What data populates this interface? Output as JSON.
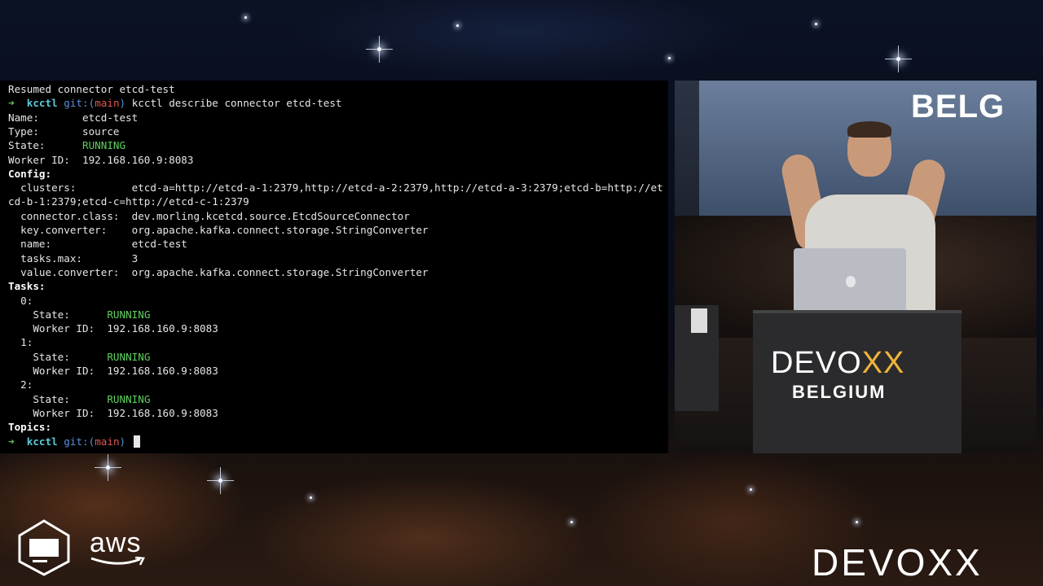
{
  "terminal": {
    "lines": [
      {
        "a": "Resumed connector etcd-test"
      },
      {
        "arrow": "➜",
        "dir": "kcctl",
        "git": "git:(",
        "branch": "main",
        "git_end": ")",
        "cmd": " kcctl describe connector etcd-test"
      },
      {
        "a": "Name:       etcd-test"
      },
      {
        "a": "Type:       source"
      },
      {
        "a": "State:      ",
        "b": "RUNNING"
      },
      {
        "a": "Worker ID:  192.168.160.9:8083"
      },
      {
        "a": "Config:"
      },
      {
        "a": "  clusters:         etcd-a=http://etcd-a-1:2379,http://etcd-a-2:2379,http://etcd-a-3:2379;etcd-b=http://et"
      },
      {
        "a": "cd-b-1:2379;etcd-c=http://etcd-c-1:2379"
      },
      {
        "a": "  connector.class:  dev.morling.kcetcd.source.EtcdSourceConnector"
      },
      {
        "a": "  key.converter:    org.apache.kafka.connect.storage.StringConverter"
      },
      {
        "a": "  name:             etcd-test"
      },
      {
        "a": "  tasks.max:        3"
      },
      {
        "a": "  value.converter:  org.apache.kafka.connect.storage.StringConverter"
      },
      {
        "a": "Tasks:"
      },
      {
        "a": "  0:"
      },
      {
        "a": "    State:      ",
        "b": "RUNNING"
      },
      {
        "a": "    Worker ID:  192.168.160.9:8083"
      },
      {
        "a": "  1:"
      },
      {
        "a": "    State:      ",
        "b": "RUNNING"
      },
      {
        "a": "    Worker ID:  192.168.160.9:8083"
      },
      {
        "a": "  2:"
      },
      {
        "a": "    State:      ",
        "b": "RUNNING"
      },
      {
        "a": "    Worker ID:  192.168.160.9:8083"
      },
      {
        "a": "Topics:"
      },
      {
        "arrow": "➜",
        "dir": "kcctl",
        "git": "git:(",
        "branch": "main",
        "git_end": ")",
        "cmd": " ",
        "cursor": true
      }
    ]
  },
  "video": {
    "screen_text": "BELG",
    "podium_brand_a": "DEVO",
    "podium_brand_x": "XX",
    "podium_sub": "BELGIUM",
    "icons": [
      "apple-icon"
    ]
  },
  "sponsors": {
    "aws_label": "aws",
    "jetbrains_icon": "jetbrains-logo-icon"
  },
  "event_logo": "DEVOXX",
  "colors": {
    "running": "#5ed05e",
    "prompt_dir": "#5fc8d6",
    "git": "#5c8fdc",
    "branch": "#e05555",
    "podium_accent": "#f0b43a"
  }
}
